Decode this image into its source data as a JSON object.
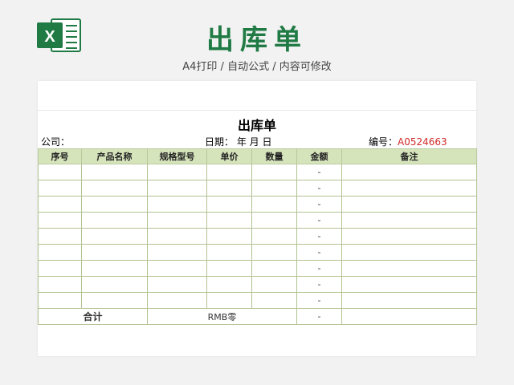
{
  "header": {
    "title": "出库单",
    "subtitle": "A4打印 / 自动公式 / 内容可修改",
    "logo_letter": "X"
  },
  "form": {
    "title": "出库单",
    "company_label": "公司：",
    "date_label": "日期：  年  月  日",
    "number_label": "编号：",
    "number_value": "A0524663"
  },
  "table": {
    "columns": [
      "序号",
      "产品名称",
      "规格型号",
      "单价",
      "数量",
      "金额",
      "备注"
    ],
    "rows": [
      {
        "amount": "-"
      },
      {
        "amount": "-"
      },
      {
        "amount": "-"
      },
      {
        "amount": "-"
      },
      {
        "amount": "-"
      },
      {
        "amount": "-"
      },
      {
        "amount": "-"
      },
      {
        "amount": "-"
      },
      {
        "amount": "-"
      }
    ],
    "total": {
      "label": "合计",
      "rmb_label": "RMB零",
      "amount": "-"
    }
  },
  "colors": {
    "brand_green": "#1f7a44",
    "header_fill": "#d6e4bc",
    "number_red": "#d02a2a"
  }
}
